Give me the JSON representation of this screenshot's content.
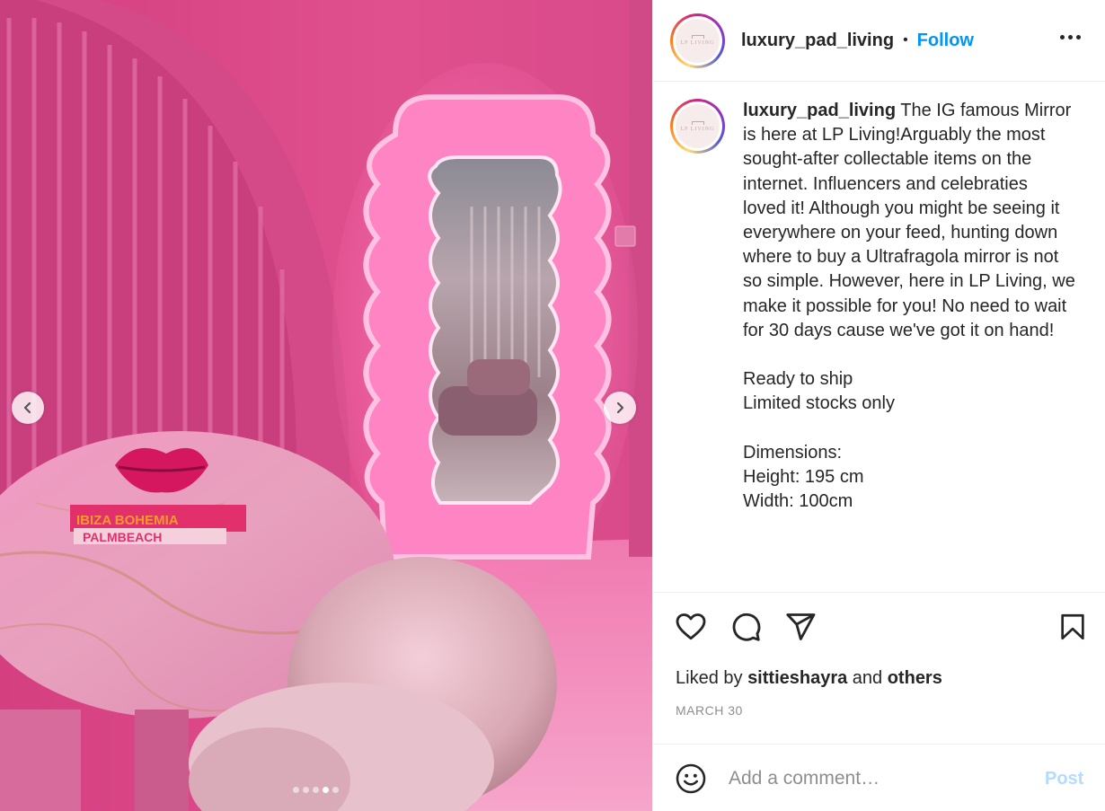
{
  "post": {
    "author": {
      "username": "luxury_pad_living",
      "avatar_text": "LP LIVING"
    },
    "header": {
      "separator": "•",
      "follow_label": "Follow"
    },
    "caption": {
      "username": "luxury_pad_living",
      "text": " The IG famous Mirror is here at LP Living!Arguably the most sought-after collectable items on the internet. Influencers and celebraties loved it! Although you might be seeing it everywhere on your feed, hunting down where to buy a Ultrafragola mirror is not so simple. However, here in LP Living, we make it possible for you! No need to wait for 30 days cause we've got it on hand!\n\nReady to ship\nLimited stocks only\n\nDimensions:\nHeight: 195 cm\nWidth: 100cm"
    },
    "media": {
      "book_title_1": "IBIZA BOHEMIA",
      "book_title_2": "PALMBEACH",
      "carousel_count": 5,
      "carousel_active": 3
    },
    "icons": {
      "more": "more-horizontal-icon",
      "like": "heart-icon",
      "comment": "comment-bubble-icon",
      "share": "paper-plane-icon",
      "save": "bookmark-icon",
      "emoji": "smiley-icon",
      "prev": "chevron-left-icon",
      "next": "chevron-right-icon"
    },
    "likes": {
      "prefix": "Liked by ",
      "user": "sittieshayra",
      "middle": " and ",
      "others": "others"
    },
    "date": "MARCH 30",
    "comment": {
      "placeholder": "Add a comment…",
      "post_label": "Post"
    },
    "colors": {
      "follow_blue": "#0095f6",
      "post_disabled": "#b3dbff",
      "secondary_text": "#8e8e8e",
      "room_pink": "#e0508e"
    }
  }
}
